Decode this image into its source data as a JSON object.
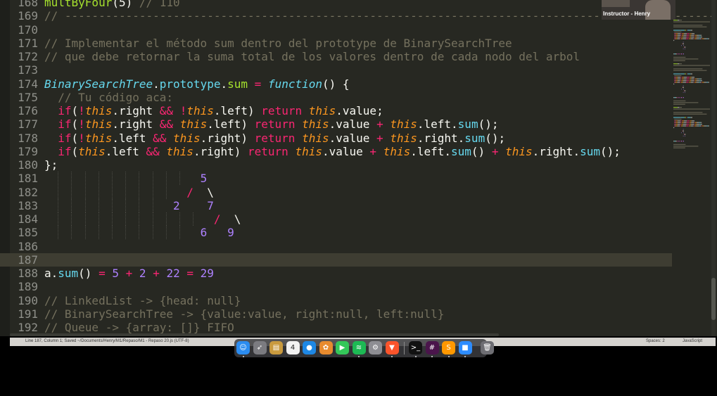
{
  "editor": {
    "language": "JavaScript",
    "lines": [
      {
        "n": "168",
        "tokens": [
          [
            "fn",
            "multByFour"
          ],
          [
            "",
            "(5) "
          ],
          [
            "cm",
            "// 110"
          ]
        ]
      },
      {
        "n": "169",
        "tokens": [
          [
            "cm",
            "// ---------------------------------------------------------------------------------------------------"
          ]
        ]
      },
      {
        "n": "170",
        "tokens": []
      },
      {
        "n": "171",
        "tokens": [
          [
            "cm",
            "// Implementar el método sum dentro del prototype de BinarySearchTree"
          ]
        ]
      },
      {
        "n": "172",
        "tokens": [
          [
            "cm",
            "// que debe retornar la suma total de los valores dentro de cada nodo del arbol"
          ]
        ]
      },
      {
        "n": "173",
        "tokens": []
      },
      {
        "n": "174",
        "tokens": [
          [
            "cls",
            "BinarySearchTree"
          ],
          [
            "",
            "."
          ],
          [
            "pr",
            "prototype"
          ],
          [
            "",
            "."
          ],
          [
            "fn",
            "sum"
          ],
          [
            "",
            " "
          ],
          [
            "op",
            "="
          ],
          [
            "",
            " "
          ],
          [
            "kw",
            "function"
          ],
          [
            "",
            "() {"
          ]
        ]
      },
      {
        "n": "175",
        "tokens": [
          [
            "",
            "  "
          ],
          [
            "cm",
            "// Tu código aca:"
          ]
        ]
      },
      {
        "n": "176",
        "tokens": [
          [
            "",
            "  "
          ],
          [
            "op",
            "if"
          ],
          [
            "",
            "("
          ],
          [
            "op",
            "!"
          ],
          [
            "th",
            "this"
          ],
          [
            "",
            ".right "
          ],
          [
            "op",
            "&&"
          ],
          [
            "",
            " "
          ],
          [
            "op",
            "!"
          ],
          [
            "th",
            "this"
          ],
          [
            "",
            ".left) "
          ],
          [
            "op",
            "return"
          ],
          [
            "",
            " "
          ],
          [
            "th",
            "this"
          ],
          [
            "",
            ".value;"
          ]
        ]
      },
      {
        "n": "177",
        "tokens": [
          [
            "",
            "  "
          ],
          [
            "op",
            "if"
          ],
          [
            "",
            "("
          ],
          [
            "op",
            "!"
          ],
          [
            "th",
            "this"
          ],
          [
            "",
            ".right "
          ],
          [
            "op",
            "&&"
          ],
          [
            "",
            " "
          ],
          [
            "th",
            "this"
          ],
          [
            "",
            ".left) "
          ],
          [
            "op",
            "return"
          ],
          [
            "",
            " "
          ],
          [
            "th",
            "this"
          ],
          [
            "",
            ".value "
          ],
          [
            "op",
            "+"
          ],
          [
            "",
            " "
          ],
          [
            "th",
            "this"
          ],
          [
            "",
            ".left."
          ],
          [
            "pr",
            "sum"
          ],
          [
            "",
            "();"
          ]
        ]
      },
      {
        "n": "178",
        "tokens": [
          [
            "",
            "  "
          ],
          [
            "op",
            "if"
          ],
          [
            "",
            "("
          ],
          [
            "op",
            "!"
          ],
          [
            "th",
            "this"
          ],
          [
            "",
            ".left "
          ],
          [
            "op",
            "&&"
          ],
          [
            "",
            " "
          ],
          [
            "th",
            "this"
          ],
          [
            "",
            ".right) "
          ],
          [
            "op",
            "return"
          ],
          [
            "",
            " "
          ],
          [
            "th",
            "this"
          ],
          [
            "",
            ".value "
          ],
          [
            "op",
            "+"
          ],
          [
            "",
            " "
          ],
          [
            "th",
            "this"
          ],
          [
            "",
            ".right."
          ],
          [
            "pr",
            "sum"
          ],
          [
            "",
            "();"
          ]
        ]
      },
      {
        "n": "179",
        "tokens": [
          [
            "",
            "  "
          ],
          [
            "op",
            "if"
          ],
          [
            "",
            "("
          ],
          [
            "th",
            "this"
          ],
          [
            "",
            ".left "
          ],
          [
            "op",
            "&&"
          ],
          [
            "",
            " "
          ],
          [
            "th",
            "this"
          ],
          [
            "",
            ".right) "
          ],
          [
            "op",
            "return"
          ],
          [
            "",
            " "
          ],
          [
            "th",
            "this"
          ],
          [
            "",
            ".value "
          ],
          [
            "op",
            "+"
          ],
          [
            "",
            " "
          ],
          [
            "th",
            "this"
          ],
          [
            "",
            ".left."
          ],
          [
            "pr",
            "sum"
          ],
          [
            "",
            "() "
          ],
          [
            "op",
            "+"
          ],
          [
            "",
            " "
          ],
          [
            "th",
            "this"
          ],
          [
            "",
            ".right."
          ],
          [
            "pr",
            "sum"
          ],
          [
            "",
            "();"
          ]
        ]
      },
      {
        "n": "180",
        "tokens": [
          [
            "",
            "};"
          ]
        ]
      },
      {
        "n": "181",
        "tokens": [
          [
            "",
            "                       "
          ],
          [
            "nu",
            "5"
          ]
        ]
      },
      {
        "n": "182",
        "tokens": [
          [
            "",
            "                     "
          ],
          [
            "op",
            "/"
          ],
          [
            "",
            "  \\"
          ]
        ]
      },
      {
        "n": "183",
        "tokens": [
          [
            "",
            "                   "
          ],
          [
            "nu",
            "2"
          ],
          [
            "",
            "    "
          ],
          [
            "nu",
            "7"
          ]
        ]
      },
      {
        "n": "184",
        "tokens": [
          [
            "",
            "                         "
          ],
          [
            "op",
            "/"
          ],
          [
            "",
            "  \\"
          ]
        ]
      },
      {
        "n": "185",
        "tokens": [
          [
            "",
            "                       "
          ],
          [
            "nu",
            "6"
          ],
          [
            "",
            "   "
          ],
          [
            "nu",
            "9"
          ]
        ]
      },
      {
        "n": "186",
        "tokens": []
      },
      {
        "n": "187",
        "tokens": [],
        "highlight": true
      },
      {
        "n": "188",
        "tokens": [
          [
            "",
            "a."
          ],
          [
            "pr",
            "sum"
          ],
          [
            "",
            "() "
          ],
          [
            "op",
            "="
          ],
          [
            "",
            " "
          ],
          [
            "nu",
            "5"
          ],
          [
            "",
            " "
          ],
          [
            "op",
            "+"
          ],
          [
            "",
            " "
          ],
          [
            "nu",
            "2"
          ],
          [
            "",
            " "
          ],
          [
            "op",
            "+"
          ],
          [
            "",
            " "
          ],
          [
            "nu",
            "22"
          ],
          [
            "",
            " "
          ],
          [
            "op",
            "="
          ],
          [
            "",
            " "
          ],
          [
            "nu",
            "29"
          ]
        ]
      },
      {
        "n": "189",
        "tokens": []
      },
      {
        "n": "190",
        "tokens": [
          [
            "cm",
            "// LinkedList -> {head: null}"
          ]
        ]
      },
      {
        "n": "191",
        "tokens": [
          [
            "cm",
            "// BinarySearchTree -> {value:value, right:null, left:null}"
          ]
        ]
      },
      {
        "n": "192",
        "tokens": [
          [
            "cm",
            "// Queue -> {array: []} FIFO"
          ]
        ]
      }
    ]
  },
  "webcam": {
    "label": "Instructor - Henry"
  },
  "statusbar": {
    "left": "Line 187, Column 1; Saved ~/Documents/Henry/M1/Repaso/M1 - Repaso 20.js (UTF-8)",
    "spaces": "Spaces: 2",
    "syntax": "JavaScript"
  },
  "dock": {
    "items": [
      {
        "name": "finder-icon",
        "glyph": "☺",
        "color": "#2b8cf0",
        "running": true
      },
      {
        "name": "launchpad-icon",
        "glyph": "➶",
        "color": "#7b7b80",
        "running": false
      },
      {
        "name": "notes-icon",
        "glyph": "▤",
        "color": "#c99a3e",
        "running": false
      },
      {
        "name": "calendar-icon",
        "glyph": "4",
        "color": "#f2f2f2",
        "running": false
      },
      {
        "name": "messages-icon",
        "glyph": "●",
        "color": "#1e88e5",
        "running": false
      },
      {
        "name": "photos-icon",
        "glyph": "✿",
        "color": "#e88b2e",
        "running": false
      },
      {
        "name": "facetime-icon",
        "glyph": "▶",
        "color": "#34c759",
        "running": false
      },
      {
        "name": "spotify-icon",
        "glyph": "≋",
        "color": "#1db954",
        "running": true
      },
      {
        "name": "system-preferences-icon",
        "glyph": "⚙",
        "color": "#8e8e93",
        "running": false
      },
      {
        "name": "brave-icon",
        "glyph": "▼",
        "color": "#fb542b",
        "running": true
      },
      {
        "name": "terminal-icon",
        "glyph": ">_",
        "color": "#111111",
        "running": true
      },
      {
        "name": "slack-icon",
        "glyph": "#",
        "color": "#4a154b",
        "running": true
      },
      {
        "name": "sublime-text-icon",
        "glyph": "S",
        "color": "#ff9800",
        "running": true
      },
      {
        "name": "zoom-icon",
        "glyph": "■",
        "color": "#2d8cff",
        "running": true
      },
      {
        "name": "trash-icon",
        "glyph": "🗑",
        "color": "#6e6e73",
        "running": false
      }
    ]
  }
}
